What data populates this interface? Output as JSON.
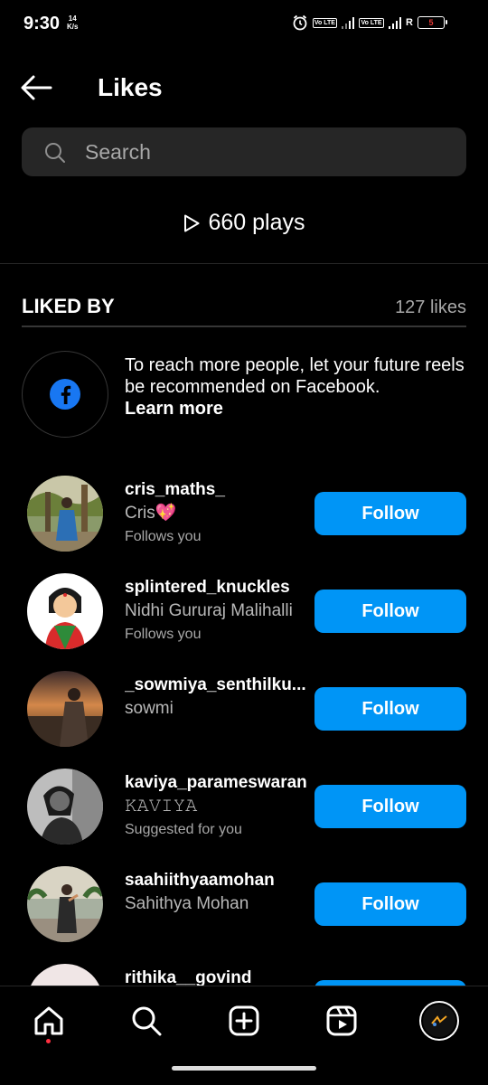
{
  "status_bar": {
    "time": "9:30",
    "speed_value": "14",
    "speed_unit": "K/s",
    "volte_label": "Vo LTE",
    "roaming": "R",
    "battery_level": "5"
  },
  "header": {
    "title": "Likes"
  },
  "search": {
    "placeholder": "Search"
  },
  "plays": {
    "text": "660 plays"
  },
  "liked_by": {
    "title": "LIKED BY",
    "count": "127 likes"
  },
  "fb_promo": {
    "text": "To reach more people, let your future reels be recommended on Facebook.",
    "link": "Learn more"
  },
  "users": [
    {
      "username": "cris_maths_",
      "fullname": "Cris💖",
      "subtext": "Follows you",
      "button": "Follow"
    },
    {
      "username": "splintered_knuckles",
      "fullname": "Nidhi Gururaj Malihalli",
      "subtext": "Follows you",
      "button": "Follow"
    },
    {
      "username": "_sowmiya_senthilku...",
      "fullname": "sowmi",
      "subtext": "",
      "button": "Follow"
    },
    {
      "username": "kaviya_parameswaran",
      "fullname": "𝙺𝙰𝚅𝙸𝚈𝙰",
      "subtext": "Suggested for you",
      "button": "Follow"
    },
    {
      "username": "saahiithyaamohan",
      "fullname": "Sahithya Mohan",
      "subtext": "",
      "button": "Follow"
    },
    {
      "username": "rithika__govind",
      "fullname": "",
      "subtext": "",
      "button": ""
    }
  ],
  "colors": {
    "background": "#000000",
    "accent": "#0095f6",
    "secondary_text": "#a8a8a8",
    "search_bg": "#262626",
    "facebook_blue": "#1877f2",
    "notification_dot": "#ff3040"
  },
  "icons": [
    "back-arrow-icon",
    "search-icon",
    "play-icon",
    "facebook-icon",
    "home-icon",
    "explore-icon",
    "create-icon",
    "reels-icon",
    "profile-avatar"
  ]
}
